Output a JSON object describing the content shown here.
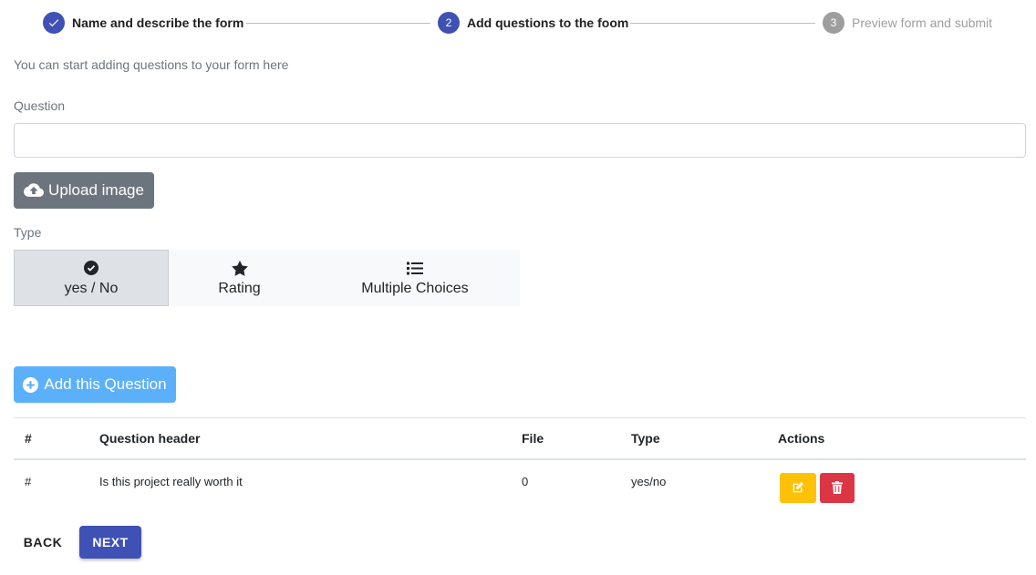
{
  "stepper": {
    "steps": [
      {
        "number": "1",
        "label": "Name and describe the form",
        "state": "completed"
      },
      {
        "number": "2",
        "label": "Add questions to the foom",
        "state": "active"
      },
      {
        "number": "3",
        "label": "Preview form and submit",
        "state": "pending"
      }
    ]
  },
  "intro_text": "You can start adding questions to your form here",
  "question": {
    "label": "Question",
    "value": "",
    "placeholder": ""
  },
  "upload_button": {
    "label": "Upload image",
    "icon": "cloud-upload-icon"
  },
  "type": {
    "label": "Type",
    "options": [
      {
        "label": "yes / No",
        "icon": "check-circle-icon",
        "selected": true
      },
      {
        "label": "Rating",
        "icon": "star-icon",
        "selected": false
      },
      {
        "label": "Multiple Choices",
        "icon": "list-icon",
        "selected": false
      }
    ]
  },
  "add_button": {
    "label": "Add this Question",
    "icon": "plus-circle-icon"
  },
  "table": {
    "headers": [
      "#",
      "Question header",
      "File",
      "Type",
      "Actions"
    ],
    "rows": [
      {
        "index": "#",
        "header": "Is this project really worth it",
        "file": "0",
        "type": "yes/no"
      }
    ]
  },
  "nav": {
    "back_label": "BACK",
    "next_label": "NEXT"
  },
  "colors": {
    "primary": "#3f51b5",
    "step_pending": "#9e9e9e",
    "upload_button": "#6c757d",
    "add_button": "#5cb0fa",
    "edit_button": "#ffc107",
    "delete_button": "#dc3545"
  }
}
